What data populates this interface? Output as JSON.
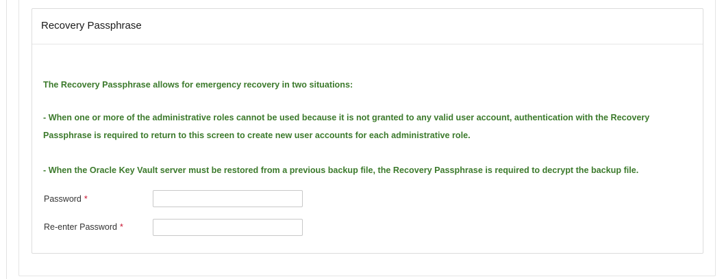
{
  "panel": {
    "title": "Recovery Passphrase"
  },
  "message": {
    "intro": "The Recovery Passphrase allows for emergency recovery in two situations:",
    "roles_line1": "- When one or more of the administrative roles cannot be used because it is not granted to any valid user account, authentication with the Recovery",
    "roles_line2": "Passphrase is required to return to this screen to create new user accounts for each administrative role.",
    "backup": "- When the Oracle Key Vault server must be restored from a previous backup file, the Recovery Passphrase is required to decrypt the backup file."
  },
  "form": {
    "password_label": "Password",
    "password_value": "",
    "reenter_label": "Re-enter Password",
    "reenter_value": "",
    "required_marker": "*"
  },
  "colors": {
    "message_text": "#3c7a2c",
    "required_marker": "#c8102e"
  }
}
